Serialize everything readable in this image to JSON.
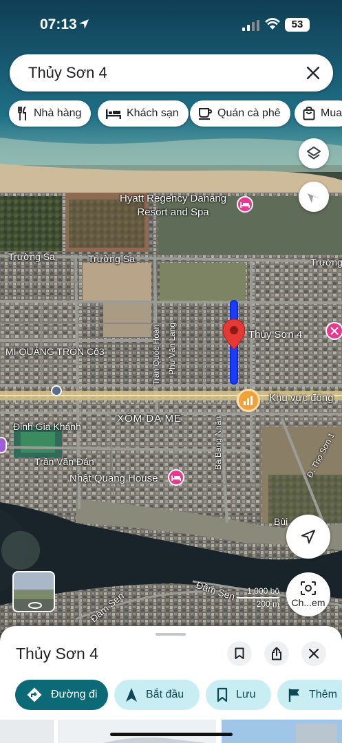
{
  "status_bar": {
    "time": "07:13",
    "battery": "53"
  },
  "search": {
    "value": "Thủy Sơn 4"
  },
  "chips": [
    {
      "label": "Nhà hàng",
      "icon": "fork-knife-icon"
    },
    {
      "label": "Khách sạn",
      "icon": "bed-icon"
    },
    {
      "label": "Quán cà phê",
      "icon": "coffee-icon"
    },
    {
      "label": "Mua",
      "icon": "shopping-bag-icon"
    }
  ],
  "map": {
    "labels": {
      "hyatt": "Hyatt Regency Danang\nResort and Spa",
      "truong_sa_1": "Trường Sa",
      "truong_sa_2": "Trường Sa",
      "truong_sa_3": "Trường",
      "tran_quoc_hoan": "Trần Quốc Hoàn",
      "phu_van_lang": "Phù Văn Lang",
      "mi_quang": "MÌ QUẢNG TRỘN Cô3",
      "thuy_son_4": "Thủy Sơn 4",
      "khu_vuc": "Khu vực đông",
      "xom_da_me": "XÓM DA ME",
      "dinh_gia_khanh": "Đinh Gia Khánh",
      "tran_van_dan": "Trần Văn Đán",
      "nhat_quang": "Nhật Quang House",
      "ba_bang_nhan": "Bà Bang Nhãn",
      "tho_son": "Đ. Thọ Sơn 1",
      "bui": "Bùi",
      "dam_sen_1": "Đầm Sen",
      "dam_sen_2": "Đầm Sen"
    },
    "scale": {
      "imperial": "1.000 bộ",
      "metric": "200 m"
    },
    "camera_button_label": "Ch...em"
  },
  "sheet": {
    "title": "Thủy Sơn 4",
    "actions": {
      "directions": "Đường đi",
      "start": "Bắt đầu",
      "save": "Lưu",
      "more": "Thêm"
    }
  },
  "colors": {
    "route_blue": "#1a3cff",
    "pin_red": "#e53935",
    "primary_teal": "#0b6a75",
    "secondary_teal": "#c8eef3",
    "hotel_pink": "#e8388f"
  }
}
